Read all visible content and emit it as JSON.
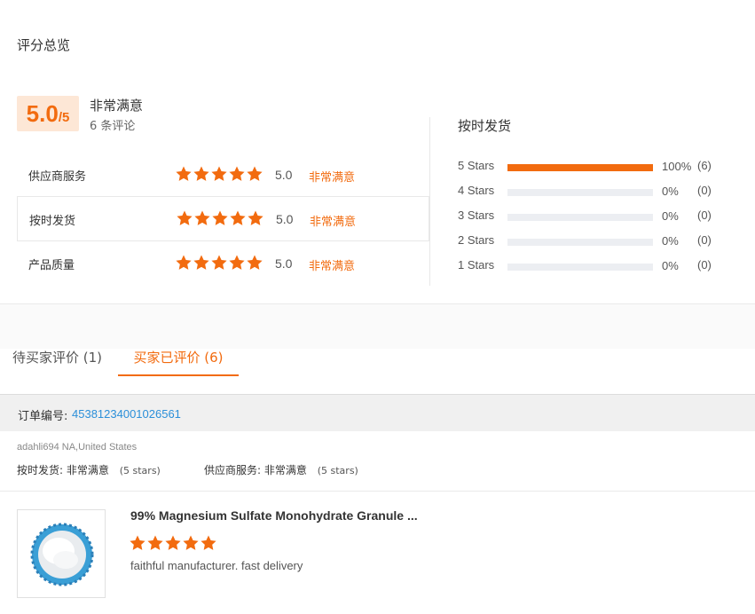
{
  "overview": {
    "title": "评分总览"
  },
  "score": {
    "value": "5.0",
    "denominator": "/5",
    "label": "非常满意",
    "review_count": "6 条评论"
  },
  "metrics": [
    {
      "name": "供应商服务",
      "stars": 5,
      "value": "5.0",
      "level": "非常满意"
    },
    {
      "name": "按时发货",
      "stars": 5,
      "value": "5.0",
      "level": "非常满意"
    },
    {
      "name": "产品质量",
      "stars": 5,
      "value": "5.0",
      "level": "非常满意"
    }
  ],
  "distribution": {
    "title": "按时发货",
    "rows": [
      {
        "label": "5  Stars",
        "fill": 1.0,
        "percent": "100%",
        "count": "(6)"
      },
      {
        "label": "4  Stars",
        "fill": 0.0,
        "percent": "0%",
        "count": "(0)"
      },
      {
        "label": "3  Stars",
        "fill": 0.0,
        "percent": "0%",
        "count": "(0)"
      },
      {
        "label": "2  Stars",
        "fill": 0.0,
        "percent": "0%",
        "count": "(0)"
      },
      {
        "label": "1  Stars",
        "fill": 0.0,
        "percent": "0%",
        "count": "(0)"
      }
    ]
  },
  "tabs": [
    {
      "label": "待买家评价 (1)",
      "active": false
    },
    {
      "label": "买家已评价 (6)",
      "active": true
    }
  ],
  "order": {
    "label": "订单编号:",
    "number": "45381234001026561"
  },
  "review": {
    "buyer": "adahli694 NA,United States",
    "ratings": [
      {
        "label": "按时发货:",
        "value": "非常满意",
        "sub": "(5 stars)"
      },
      {
        "label": "供应商服务:",
        "value": "非常满意",
        "sub": "(5 stars)"
      }
    ],
    "product_title": "99% Magnesium Sulfate Monohydrate Granule ...",
    "stars": 5,
    "text": "faithful manufacturer. fast delivery"
  },
  "colors": {
    "accent": "#f26b0f",
    "link": "#2b8fd9",
    "track": "#eceef2",
    "score_bg": "#fde7d6"
  },
  "icons": {
    "star": "star-icon",
    "thumbnail": "product-thumbnail"
  }
}
